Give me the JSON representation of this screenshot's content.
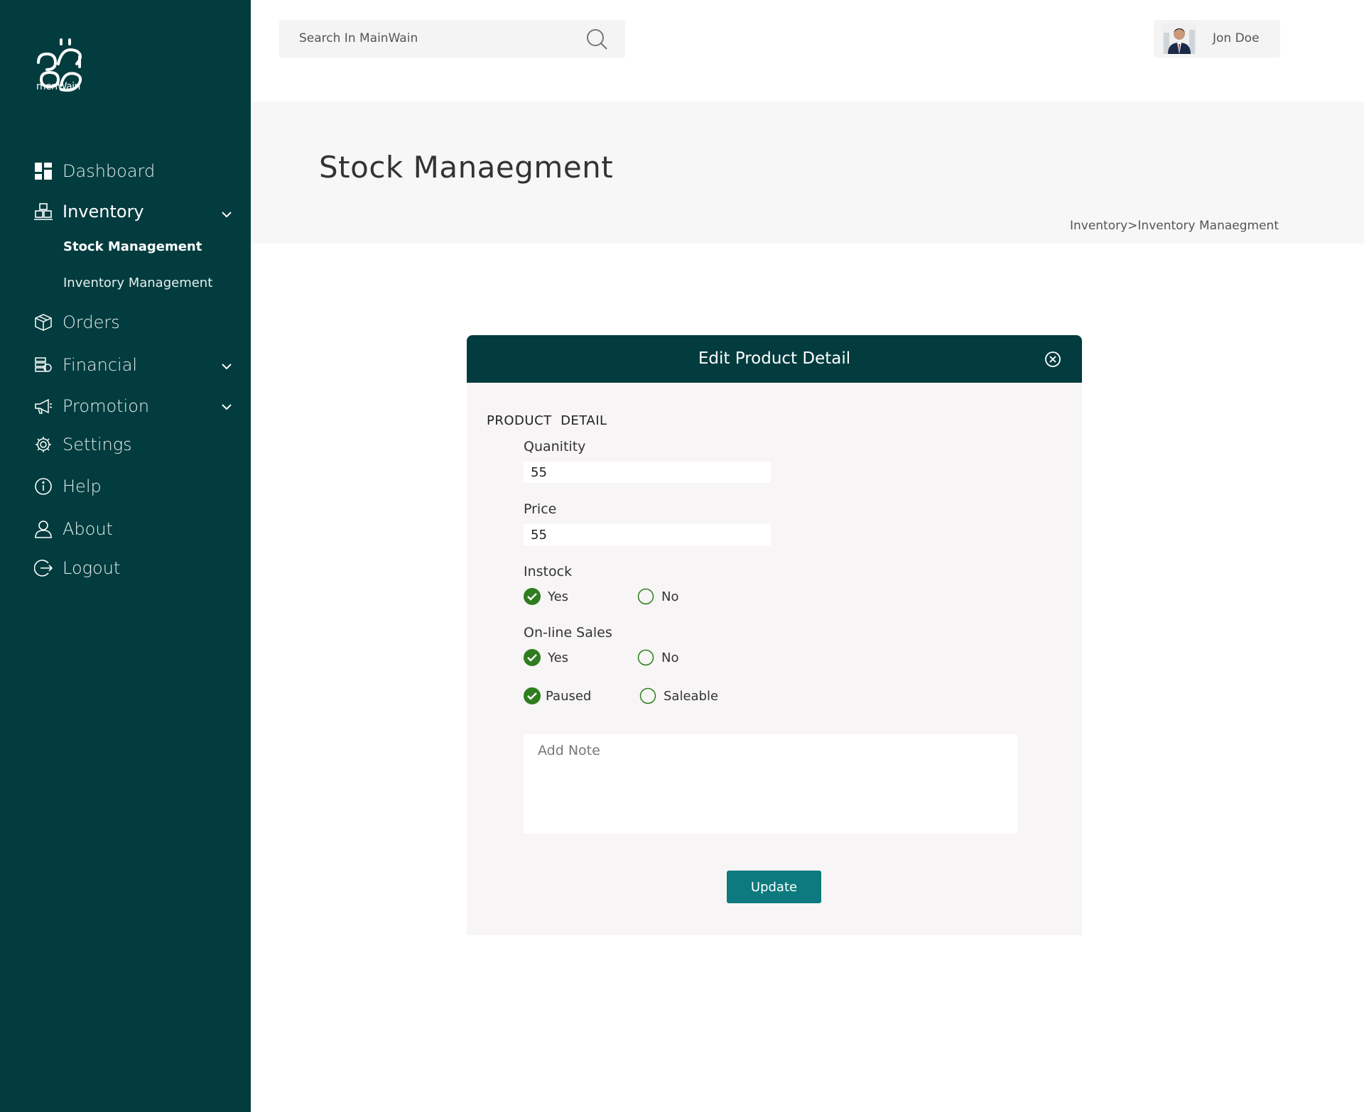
{
  "logo": {
    "text": "menWain"
  },
  "sidebar": {
    "dashboard": "Dashboard",
    "inventory": "Inventory",
    "stock_management": "Stock Management",
    "inventory_management": "Inventory Management",
    "orders": "Orders",
    "financial": "Financial",
    "promotion": "Promotion",
    "settings": "Settings",
    "help": "Help",
    "about": "About",
    "logout": "Logout"
  },
  "search": {
    "placeholder": "Search In MainWain"
  },
  "user": {
    "name": "Jon Doe"
  },
  "page": {
    "title": "Stock Manaegment",
    "breadcrumb": "Inventory>Inventory Manaegment"
  },
  "modal": {
    "title": "Edit Product Detail",
    "section": "PRODUCT  DETAIL",
    "quantity_label": "Quanitity",
    "quantity_value": "55",
    "price_label": "Price",
    "price_value": "55",
    "instock_label": "Instock",
    "instock_yes": "Yes",
    "instock_no": "No",
    "online_label": "On-line Sales",
    "online_yes": "Yes",
    "online_no": "No",
    "paused": "Paused",
    "saleable": "Saleable",
    "note_placeholder": "Add Note",
    "update": "Update"
  },
  "colors": {
    "sidebar_bg": "#033c3e",
    "accent": "#0c7a7e",
    "check_green": "#2e7d1e"
  }
}
